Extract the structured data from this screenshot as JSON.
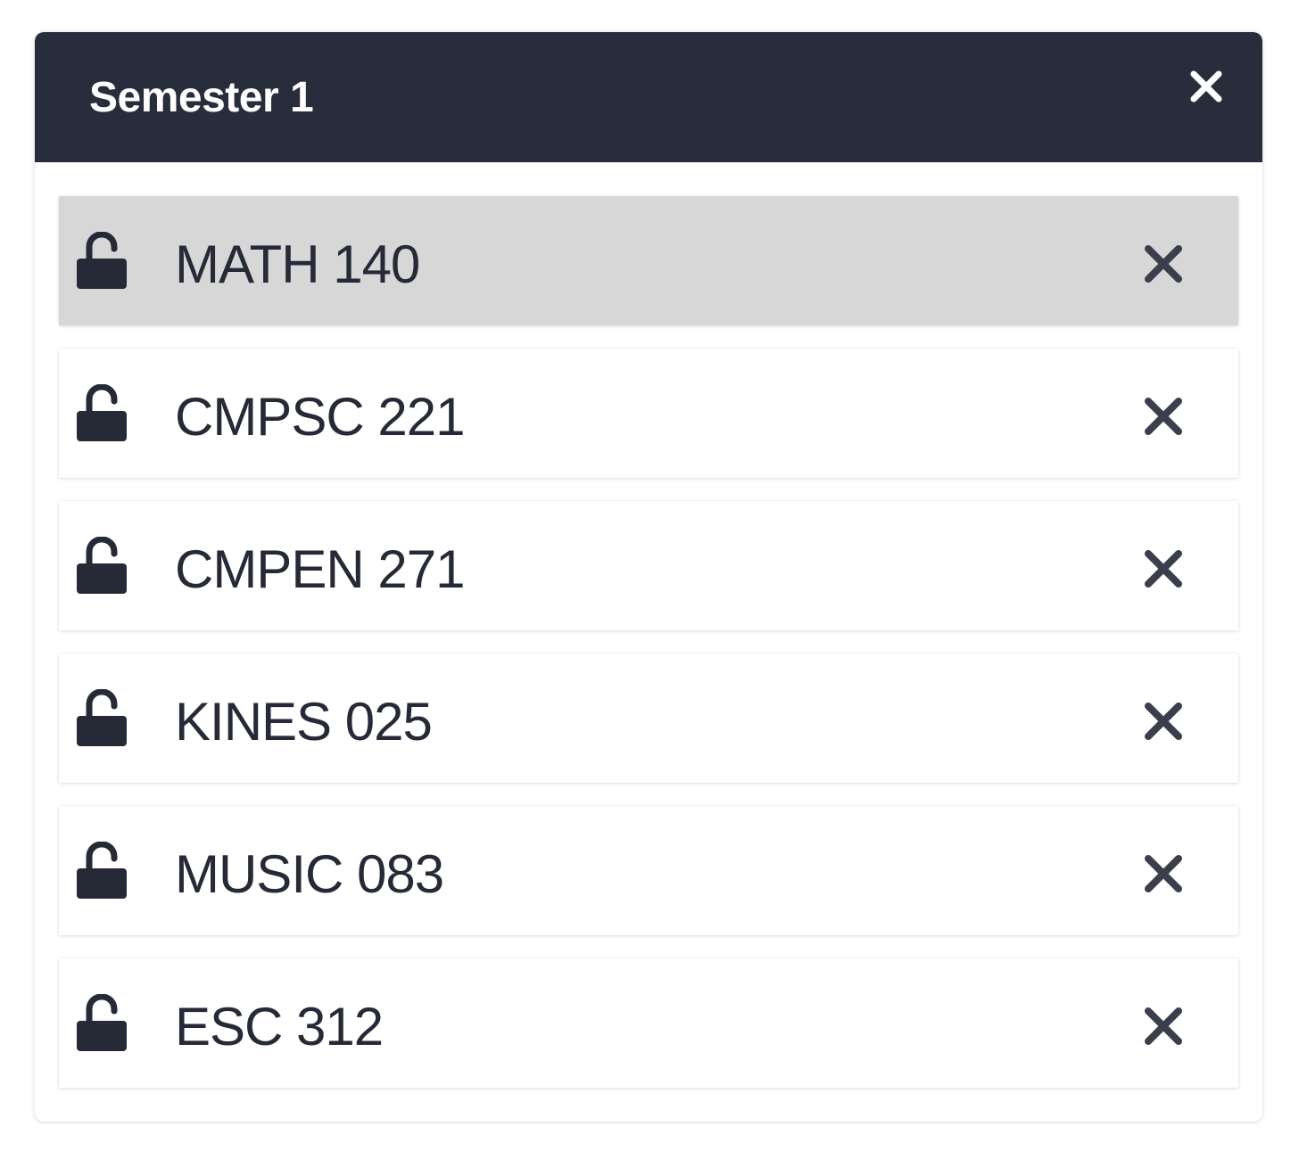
{
  "semester": {
    "title": "Semester 1",
    "close_icon": "close-icon"
  },
  "courses": [
    {
      "name": "MATH 140",
      "selected": true,
      "lock_icon": "unlocked-padlock-icon",
      "remove_icon": "close-icon"
    },
    {
      "name": "CMPSC 221",
      "selected": false,
      "lock_icon": "unlocked-padlock-icon",
      "remove_icon": "close-icon"
    },
    {
      "name": "CMPEN 271",
      "selected": false,
      "lock_icon": "unlocked-padlock-icon",
      "remove_icon": "close-icon"
    },
    {
      "name": "KINES 025",
      "selected": false,
      "lock_icon": "unlocked-padlock-icon",
      "remove_icon": "close-icon"
    },
    {
      "name": "MUSIC 083",
      "selected": false,
      "lock_icon": "unlocked-padlock-icon",
      "remove_icon": "close-icon"
    },
    {
      "name": "ESC 312",
      "selected": false,
      "lock_icon": "unlocked-padlock-icon",
      "remove_icon": "close-icon"
    }
  ],
  "colors": {
    "header_bg": "#282d3c",
    "header_text": "#ffffff",
    "item_text": "#262a36",
    "selected_item_bg": "#d7d7d7",
    "icon": "#262a36",
    "remove_icon": "#3a3f4b"
  }
}
